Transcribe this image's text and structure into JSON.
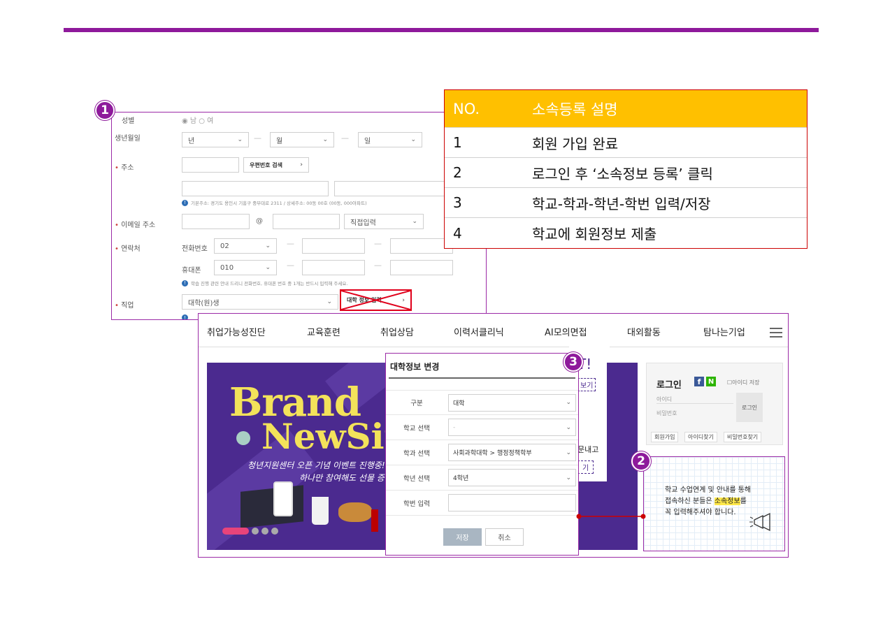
{
  "steps": [
    "1",
    "2",
    "3"
  ],
  "form": {
    "gender_label": "성별",
    "gender_options": "◉ 남 ○ 여",
    "birth_label": "생년월일",
    "birth_year": "년",
    "birth_month": "월",
    "birth_day": "일",
    "address_label": "주소",
    "zip_button": "우편번호 검색",
    "address_hint": "기본주소: 경기도 용인시 기흥구 중부대로 2311 / 상세주소: 00동 00호 (00동, 000아파트)",
    "email_label": "이메일 주소",
    "email_at": "@",
    "email_domain": "직접입력",
    "contact_label": "연락처",
    "phone_label": "전화번호",
    "phone_prefix": "02",
    "mobile_label": "휴대폰",
    "mobile_prefix": "010",
    "contact_hint": "학습 진행 관련 안내 드리니 전화번호, 휴대폰 번호 중 1개는 반드시 입력해 주세요.",
    "job_label": "직업",
    "job_value": "대학(원)생",
    "univ_button": "대학 정보 입력"
  },
  "table": {
    "header_no": "NO.",
    "header_desc": "소속등록 설명",
    "rows": [
      {
        "no": "1",
        "desc": "회원 가입 완료"
      },
      {
        "no": "2",
        "desc": "로그인 후 ‘소속정보 등록’ 클릭"
      },
      {
        "no": "3",
        "desc": "학교-학과-학년-학번 입력/저장"
      },
      {
        "no": "4",
        "desc": "학교에 회원정보 제출"
      }
    ]
  },
  "site": {
    "nav": [
      "취업가능성진단",
      "교육훈련",
      "취업상담",
      "이력서클리닉",
      "AI모의면접",
      "대외활동",
      "탐나는기업"
    ],
    "banner_title1": "Brand",
    "banner_title2": "NewSit",
    "banner_sub1": "청년지원센터 오픈 기념 이벤트 진행중!",
    "banner_sub2": "하나만 참여해도 선물 증정!",
    "ticket_text1": "T!",
    "ticket_link1": "보기",
    "ticket_text2": "문내고",
    "ticket_link2": "기",
    "login_title": "로그인",
    "save_id": "아이디 저장",
    "id_placeholder": "아이디",
    "pw_placeholder": "비밀번호",
    "login_button": "로그인",
    "links": [
      "회원가입",
      "아이디찾기",
      "비밀번호찾기"
    ],
    "notice_line1": "학교 수업연계 및 안내를 통해",
    "notice_line2a": "접속하신 분들은 ",
    "notice_highlight": "소속정보",
    "notice_line2b": "를",
    "notice_line3": "꼭 입력해주셔야 합니다."
  },
  "modal": {
    "title": "대학정보 변경",
    "rows": [
      {
        "label": "구분",
        "value": "대학"
      },
      {
        "label": "학교 선택",
        "value": "-"
      },
      {
        "label": "학과 선택",
        "value": "사회과학대학 > 행정정책학부"
      },
      {
        "label": "학년 선택",
        "value": "4학년"
      },
      {
        "label": "학번 입력",
        "value": ""
      }
    ],
    "save": "저장",
    "cancel": "취소"
  },
  "colors": {
    "accent": "#8e1a9b",
    "header": "#ffc000",
    "border_red": "#cc0000"
  }
}
